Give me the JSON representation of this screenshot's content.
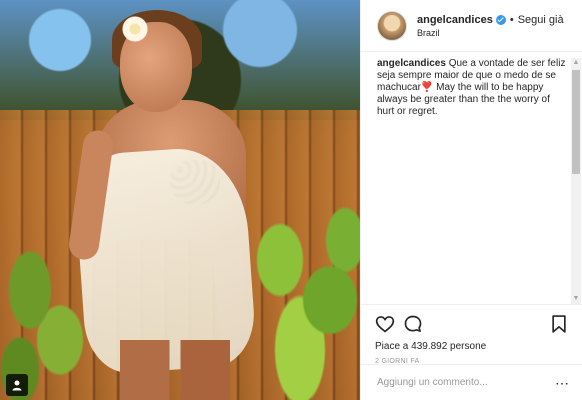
{
  "post": {
    "username": "angelcandices",
    "separator": "•",
    "follow_label": "Segui già",
    "location": "Brazil",
    "caption_user": "angelcandices",
    "caption_text": "Que a vontade de ser feliz seja sempre maior de que o medo de se machucar❣️ May the will to be happy always be greater than the the worry of hurt or regret.",
    "likes": "Piace a 439.892 persone",
    "time": "2 GIORNI FA",
    "comment_placeholder": "Aggiungi un commento..."
  },
  "icons": {
    "verified": "verified-badge-icon",
    "like": "heart-icon",
    "comment": "comment-bubble-icon",
    "save": "bookmark-icon",
    "more": "more-options-icon",
    "user_tag": "user-tag-icon"
  },
  "colors": {
    "verified_blue": "#3897f0",
    "text": "#262626",
    "muted": "#999999",
    "border": "#efefef"
  }
}
